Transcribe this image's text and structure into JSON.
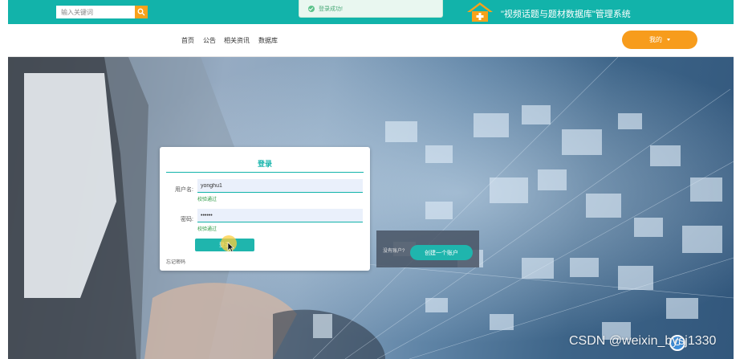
{
  "search": {
    "placeholder": "输入关键词"
  },
  "toast": {
    "message": "登录成功!"
  },
  "header": {
    "site_title": "\"视频话题与题材数据库\"管理系统"
  },
  "nav": {
    "items": [
      "首页",
      "公告",
      "相关资讯",
      "数据库"
    ],
    "user_menu_label": "我的"
  },
  "login": {
    "title": "登录",
    "username_label": "用户名:",
    "username_value": "yonghu1",
    "username_hint": "校验通过",
    "password_label": "密码:",
    "password_value": "123456",
    "password_hint": "校验通过",
    "submit_label": "登录",
    "forgot_label": "忘记密码"
  },
  "register": {
    "prompt": "没有账户?",
    "button_label": "创建一个账户"
  },
  "watermark": {
    "text": "CSDN @weixin_bysj1330"
  },
  "colors": {
    "accent": "#12b3aa",
    "orange": "#f79c1c",
    "success": "#2b9a44"
  },
  "icons": [
    "search-icon",
    "check-circle-icon",
    "house-logo-icon",
    "chevron-down-icon",
    "cursor-icon"
  ]
}
